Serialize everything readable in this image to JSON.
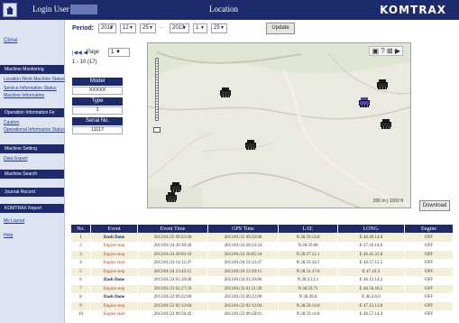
{
  "topbar": {
    "user_label": "Login User",
    "page_title": "Location",
    "brand": "KOMTRAX"
  },
  "sidebar": {
    "top_link": "Close",
    "sections": [
      {
        "title": "Machine Monitoring",
        "links": [
          "Location Work Machine Status",
          "Service Information Status",
          "Machine Information"
        ]
      },
      {
        "title": "Operation Information Fe",
        "links": [
          "Caution",
          "Operational Information Status"
        ]
      },
      {
        "title": "Machine Setting",
        "links": [
          "Data Export"
        ]
      }
    ],
    "menu_items": [
      "Machine Search",
      "Journal Record",
      "KOMTRAX Report"
    ],
    "bottom_links": [
      "My Layout",
      "Help"
    ]
  },
  "period": {
    "label": "Period:",
    "from": {
      "year": "2012",
      "month": "12",
      "day": "25"
    },
    "to": {
      "year": "2013",
      "month": "1",
      "day": "25"
    },
    "update_label": "Update"
  },
  "paging": {
    "icons": "|◀◀ ◀",
    "text": "Page",
    "page_value": "1",
    "count": "1 - 10 (17)"
  },
  "machine": {
    "model_label": "Model",
    "model_value": "XXXXX",
    "type_label": "Type",
    "type_value": "1",
    "serial_label": "Serial No.",
    "serial_value": "11117"
  },
  "map": {
    "tools": "▣ ? ⊠ ▶",
    "zoom_out": "−",
    "scale": "200 m | 1000 ft"
  },
  "download_label": "Download",
  "table": {
    "headers": [
      "No.",
      "Event",
      "Event Time",
      "GPS Time",
      "LAT.",
      "LONG.",
      "Engine"
    ],
    "rows": [
      [
        "1",
        "Dash Done",
        "2013/01/25 09:22:00",
        "2013/01/25 09:22:00",
        "N 28.59.14.8",
        "E 46.49.14.0",
        "OFF"
      ],
      [
        "2",
        "Engine stop",
        "2013/01/24 20:30:28",
        "2013/01/24 20:32:24",
        "N 28.59.08",
        "E 47.16.14.0",
        "OFF"
      ],
      [
        "3",
        "Engine stop",
        "2013/01/24 20:03:10",
        "2013/01/24 20:05:24",
        "N 28.27.12.1",
        "E 46.41.22.8",
        "OFF"
      ],
      [
        "4",
        "Engine start",
        "2013/01/24 14:12:47",
        "2013/01/24 14:12:47",
        "N 28.59.16.1",
        "E 46.57.12.5",
        "OFF"
      ],
      [
        "5",
        "Engine stop",
        "2013/01/24 13:42:15",
        "2013/01/24 13:39:15",
        "N 28.31.17.8",
        "E 47.16.3",
        "OFF"
      ],
      [
        "6",
        "Dash Done",
        "2013/01/24 01:20:00",
        "2013/01/24 01:20:00",
        "N 28.3.12.1",
        "E 46.13.14.2",
        "OFF"
      ],
      [
        "7",
        "Engine stop",
        "2013/01/23 01:27:59",
        "2013/01/23 01:21:20",
        "N 28.59.71",
        "E 46.56.18.5",
        "OFF"
      ],
      [
        "8",
        "Dash Done",
        "2013/01/22 09:22:00",
        "2013/01/22 09:22:00",
        "N 28.49.8",
        "E 46.3.0.0",
        "OFF"
      ],
      [
        "9",
        "Engine stop",
        "2013/01/22 02:12:04",
        "2013/01/22 02:12:04",
        "N 28.59.14.8",
        "E 47.15.13.8",
        "OFF"
      ],
      [
        "10",
        "Engine start",
        "2013/01/22 00:56:42",
        "2013/01/22 00:58:01",
        "N 28.59.14.8",
        "E 46.57.14.4",
        "OFF"
      ]
    ]
  }
}
